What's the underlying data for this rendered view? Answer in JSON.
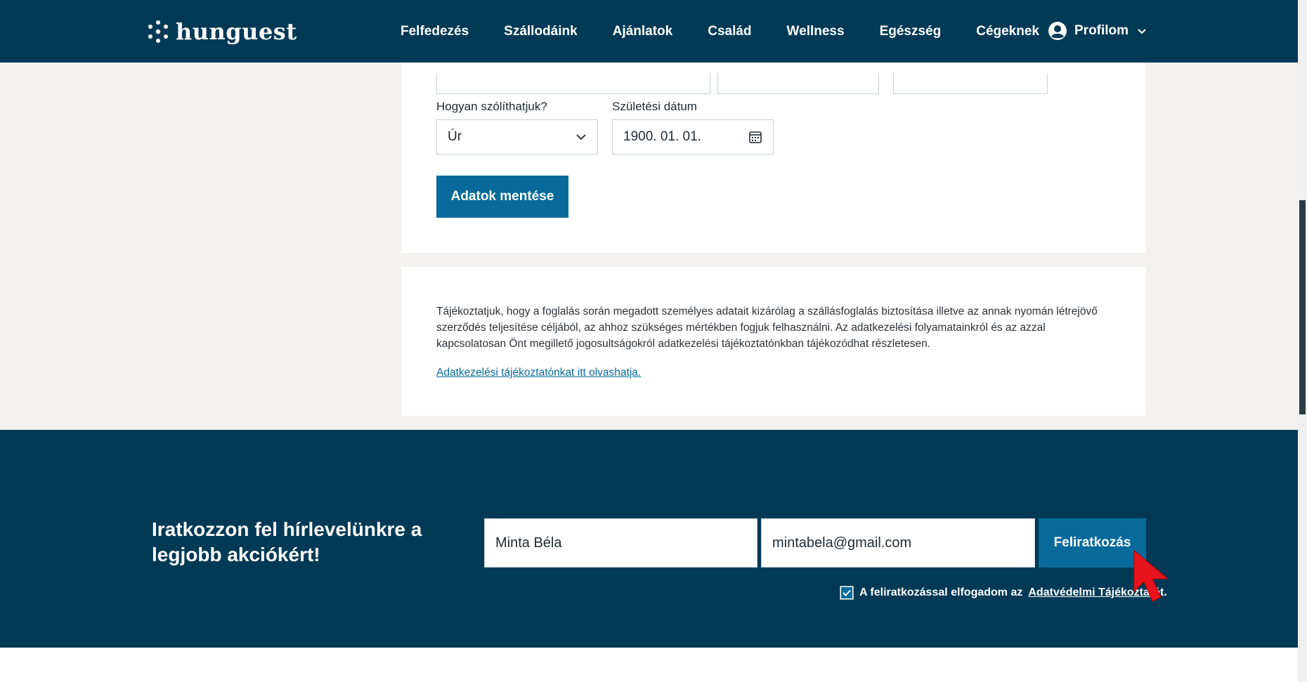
{
  "brand": {
    "name": "hunguest"
  },
  "nav": {
    "items": [
      "Felfedezés",
      "Szállodáink",
      "Ajánlatok",
      "Család",
      "Wellness",
      "Egészség",
      "Cégeknek"
    ]
  },
  "profile": {
    "label": "Profilom"
  },
  "form": {
    "salutation_label": "Hogyan szólíthatjuk?",
    "salutation_value": "Úr",
    "birthdate_label": "Születési dátum",
    "birthdate_value": "1900. 01. 01.",
    "save_label": "Adatok mentése"
  },
  "info": {
    "text": "Tájékoztatjuk, hogy a foglalás során megadott személyes adatait kizárólag a szállásfoglalás biztosítása illetve az annak nyomán létrejövő szerződés teljesítése céljából, az ahhoz szükséges mértékben fogjuk felhasználni. Az adatkezelési folyamatainkról és az azzal kapcsolatosan Önt megillető jogosultságokról adatkezelési tájékoztatónkban tájékozódhat részletesen.",
    "link": "Adatkezelési tájékoztatónkat itt olvashatja."
  },
  "newsletter": {
    "title": "Iratkozzon fel hírlevelünkre a legjobb akciókért!",
    "name_value": "Minta Béla",
    "email_value": "mintabela@gmail.com",
    "subscribe_label": "Feliratkozás",
    "consent_text": "A feliratkozással elfogadom az",
    "consent_link": "Adatvédelmi Tájékoztató",
    "consent_suffix": "t.",
    "consent_checked": true
  },
  "colors": {
    "header_bg": "#023a56",
    "accent": "#076a9b",
    "page_bg": "#f3f2f0"
  }
}
